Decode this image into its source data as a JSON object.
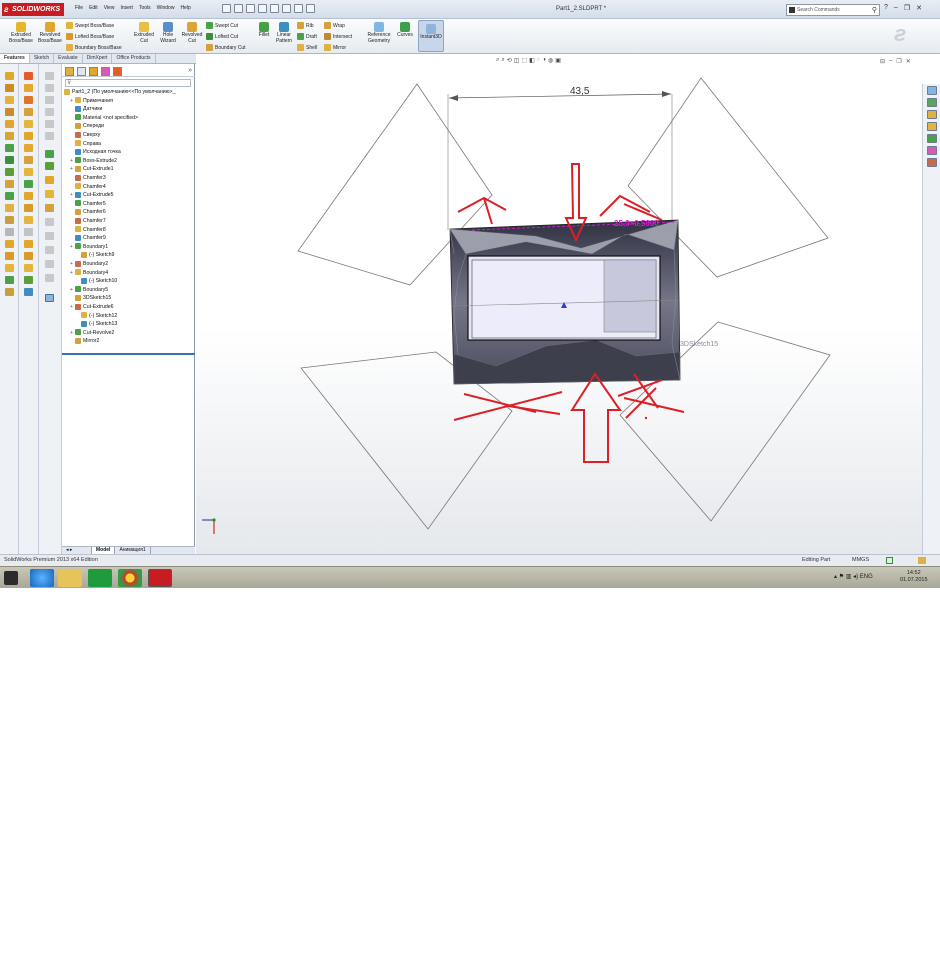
{
  "app": {
    "logo_text": "SOLIDWORKS",
    "doc_title": "Part1_2.SLDPRT *",
    "menu": [
      "File",
      "Edit",
      "View",
      "Insert",
      "Tools",
      "Window",
      "Help"
    ],
    "search_placeholder": "Search Commands"
  },
  "ribbon": {
    "big_buttons": [
      {
        "label1": "Extruded",
        "label2": "Boss/Base"
      },
      {
        "label1": "Revolved",
        "label2": "Boss/Base"
      },
      {
        "label1": "Extruded",
        "label2": "Cut"
      },
      {
        "label1": "Hole",
        "label2": "Wizard"
      },
      {
        "label1": "Revolved",
        "label2": "Cut"
      },
      {
        "label1": "Fillet",
        "label2": ""
      },
      {
        "label1": "Linear",
        "label2": "Pattern"
      },
      {
        "label1": "Reference",
        "label2": "Geometry"
      },
      {
        "label1": "Curves",
        "label2": ""
      },
      {
        "label1": "Instant3D",
        "label2": ""
      }
    ],
    "small_buttons": [
      "Swept Boss/Base",
      "Lofted Boss/Base",
      "Boundary Boss/Base",
      "Swept Cut",
      "Lofted Cut",
      "Boundary Cut",
      "Rib",
      "Draft",
      "Shell",
      "Wrap",
      "Intersect",
      "Mirror"
    ]
  },
  "tabs": [
    "Features",
    "Sketch",
    "Evaluate",
    "DimXpert",
    "Office Products"
  ],
  "tree": {
    "root": "Part1_2  (По умолчанию<<По умолчанию>_",
    "nodes": [
      {
        "label": "Примечания",
        "indent": 1,
        "exp": true
      },
      {
        "label": "Датчики",
        "indent": 1,
        "exp": false
      },
      {
        "label": "Material <not specified>",
        "indent": 1,
        "exp": false
      },
      {
        "label": "Спереди",
        "indent": 1,
        "exp": false
      },
      {
        "label": "Сверху",
        "indent": 1,
        "exp": false
      },
      {
        "label": "Справа",
        "indent": 1,
        "exp": false
      },
      {
        "label": "Исходная точка",
        "indent": 1,
        "exp": false
      },
      {
        "label": "Boss-Extrude2",
        "indent": 1,
        "exp": true
      },
      {
        "label": "Cut-Extrude1",
        "indent": 1,
        "exp": true
      },
      {
        "label": "Chamfer3",
        "indent": 1,
        "exp": false
      },
      {
        "label": "Chamfer4",
        "indent": 1,
        "exp": false
      },
      {
        "label": "Cut-Extrude5",
        "indent": 1,
        "exp": true
      },
      {
        "label": "Chamfer5",
        "indent": 1,
        "exp": false
      },
      {
        "label": "Chamfer6",
        "indent": 1,
        "exp": false
      },
      {
        "label": "Chamfer7",
        "indent": 1,
        "exp": false
      },
      {
        "label": "Chamfer8",
        "indent": 1,
        "exp": false
      },
      {
        "label": "Chamfer9",
        "indent": 1,
        "exp": false
      },
      {
        "label": "Boundary1",
        "indent": 1,
        "exp": true
      },
      {
        "label": "(-) Sketch9",
        "indent": 2,
        "exp": false
      },
      {
        "label": "Boundary2",
        "indent": 1,
        "exp": true
      },
      {
        "label": "Boundary4",
        "indent": 1,
        "exp": true
      },
      {
        "label": "(-) Sketch10",
        "indent": 2,
        "exp": false
      },
      {
        "label": "Boundary5",
        "indent": 1,
        "exp": true
      },
      {
        "label": "3DSketch15",
        "indent": 1,
        "exp": false
      },
      {
        "label": "Cut-Extrude6",
        "indent": 1,
        "exp": true
      },
      {
        "label": "(-) Sketch12",
        "indent": 2,
        "exp": false
      },
      {
        "label": "(-) Sketch13",
        "indent": 2,
        "exp": false
      },
      {
        "label": "Cut-Revolve2",
        "indent": 1,
        "exp": true
      },
      {
        "label": "Mirror2",
        "indent": 1,
        "exp": false
      }
    ]
  },
  "bottom_tabs": [
    "Model",
    "Анимация1"
  ],
  "viewport": {
    "dimension_value": "43,5",
    "dim_magenta": "25,0×0,5000",
    "sketch_label": "3DSketch15"
  },
  "status": {
    "left": "SolidWorks Premium 2013 x64 Edition",
    "mode": "Editing Part",
    "units": "MMGS"
  },
  "taskbar": {
    "time": "14:52",
    "date": "01.07.2015",
    "lang": "ENG"
  }
}
